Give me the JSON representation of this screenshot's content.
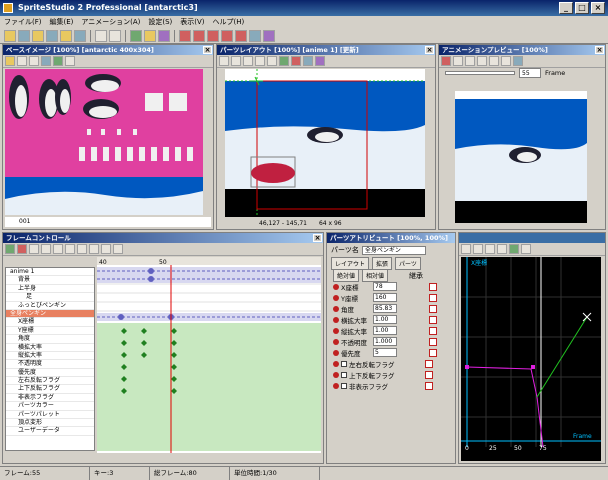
{
  "app": {
    "title": "SpriteStudio 2 Professional [antarctic3]"
  },
  "menu": [
    "ファイル(F)",
    "編集(E)",
    "アニメーション(A)",
    "設定(S)",
    "表示(V)",
    "ヘルプ(H)"
  ],
  "panels": {
    "base_image": {
      "title": "ベースイメージ [100%] [antarctic 400x304]",
      "tab_label": "001"
    },
    "parts_layout": {
      "title": "パーツレイアウト [100%] [anime 1] [更新]",
      "coords": "46,127 - 145,71",
      "size": "64 x 96"
    },
    "preview": {
      "title": "アニメーションプレビュー [100%]",
      "frame_value": "55",
      "frame_label": "Frame"
    },
    "frame_control": {
      "title": "フレームコントロール"
    },
    "part_attr": {
      "title": "パーツアトリビュート [100%, 100%]",
      "part_name_label": "パーツ名",
      "part_name": "全身ペンギン",
      "tabs": [
        "レイアウト",
        "拡張",
        "パーツ"
      ],
      "subtabs": [
        "絶対値",
        "相対値"
      ],
      "inherit_label": "継承",
      "attributes": [
        {
          "label": "X座標",
          "value": "78"
        },
        {
          "label": "Y座標",
          "value": "160"
        },
        {
          "label": "角度",
          "value": "85.83"
        },
        {
          "label": "横拡大率",
          "value": "1.00"
        },
        {
          "label": "縦拡大率",
          "value": "1.00"
        },
        {
          "label": "不透明度",
          "value": "1.000"
        },
        {
          "label": "優先度",
          "value": "5"
        }
      ],
      "flags": [
        "左右反転フラグ",
        "上下反転フラグ",
        "非表示フラグ"
      ]
    },
    "graph": {
      "y_label": "X座標",
      "x_label": "Frame",
      "x_ticks": [
        "0",
        "25",
        "50",
        "75"
      ]
    }
  },
  "timeline": {
    "ruler_ticks": [
      "40",
      "50"
    ],
    "tree": [
      {
        "label": "anime 1",
        "level": 0,
        "selected": false
      },
      {
        "label": "背景",
        "level": 1,
        "selected": false
      },
      {
        "label": "上半身",
        "level": 1,
        "selected": false
      },
      {
        "label": "足",
        "level": 2,
        "selected": false
      },
      {
        "label": "ふっとびペンギン",
        "level": 1,
        "selected": false
      },
      {
        "label": "全身ペンギン",
        "level": 1,
        "selected": true
      },
      {
        "label": "X座標",
        "level": 2,
        "selected": false
      },
      {
        "label": "Y座標",
        "level": 2,
        "selected": false
      },
      {
        "label": "角度",
        "level": 2,
        "selected": false
      },
      {
        "label": "横拡大率",
        "level": 2,
        "selected": false
      },
      {
        "label": "縦拡大率",
        "level": 2,
        "selected": false
      },
      {
        "label": "不透明度",
        "level": 2,
        "selected": false
      },
      {
        "label": "優先度",
        "level": 2,
        "selected": false
      },
      {
        "label": "左右反転フラグ",
        "level": 2,
        "selected": false
      },
      {
        "label": "上下反転フラグ",
        "level": 2,
        "selected": false
      },
      {
        "label": "非表示フラグ",
        "level": 2,
        "selected": false
      },
      {
        "label": "パーツカラー",
        "level": 2,
        "selected": false
      },
      {
        "label": "パーツパレット",
        "level": 2,
        "selected": false
      },
      {
        "label": "頂点変形",
        "level": 2,
        "selected": false
      },
      {
        "label": "ユーザーデータ",
        "level": 2,
        "selected": false
      }
    ]
  },
  "status": {
    "frame": "フレーム:55",
    "key": "キー:3",
    "total": "総フレーム:80",
    "unit": "単位時間:1/30"
  },
  "colors": {
    "magenta_bg": "#e040a0",
    "sky": "#0058c0",
    "snow": "#e8f0f8"
  }
}
